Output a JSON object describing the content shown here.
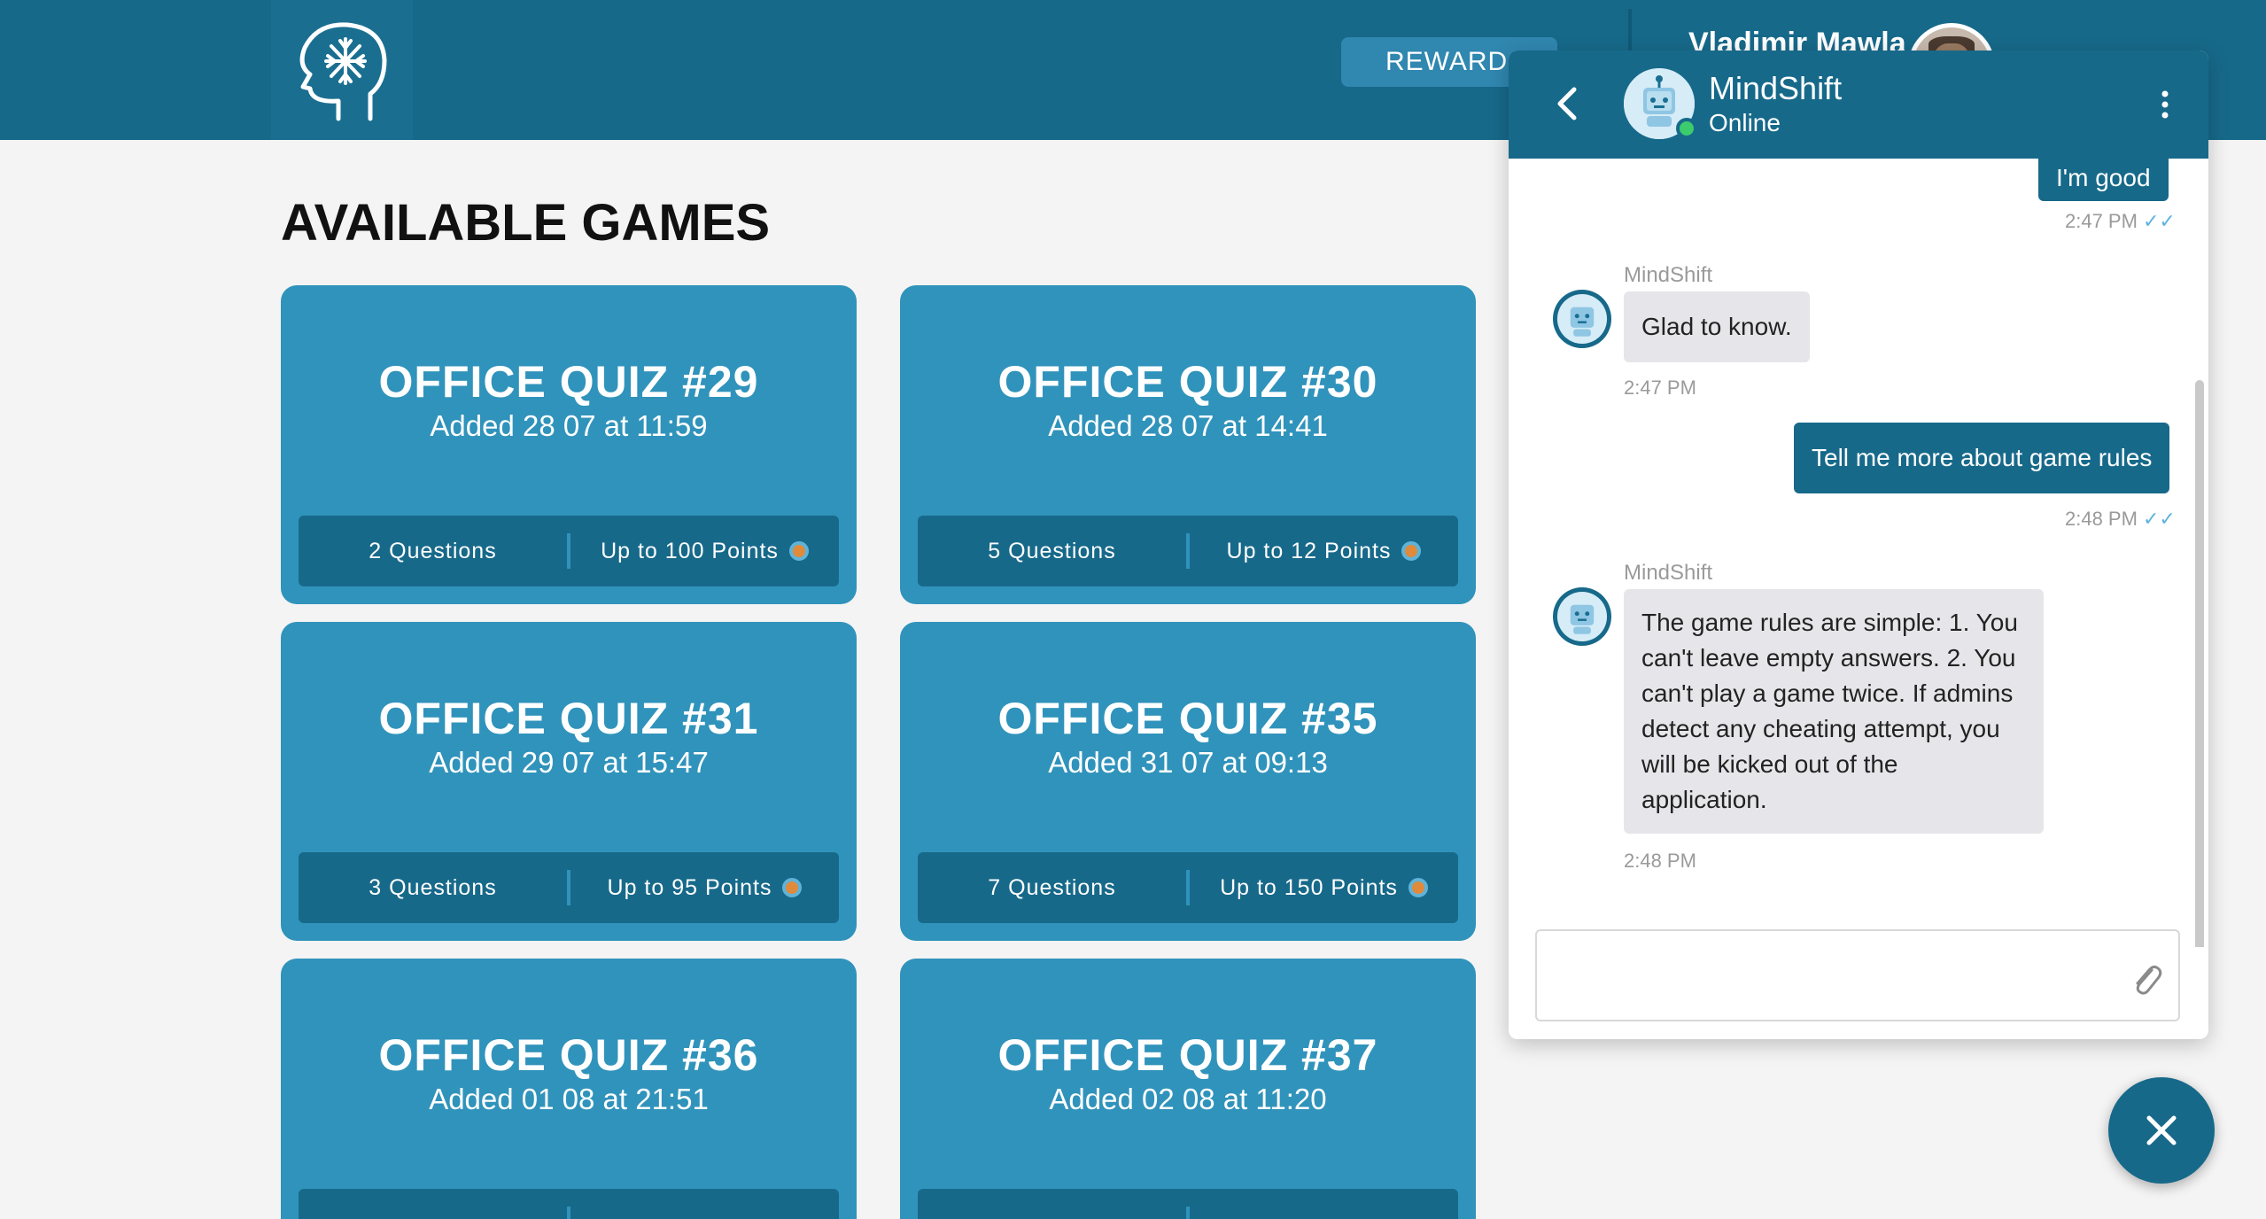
{
  "header": {
    "rewards_label": "REWARDS",
    "user_name": "Vladimir Mawla"
  },
  "main": {
    "title": "AVAILABLE GAMES",
    "games": [
      {
        "title": "OFFICE QUIZ #29",
        "added": "Added 28 07 at 11:59",
        "questions": "2 Questions",
        "points": "Up to 100 Points"
      },
      {
        "title": "OFFICE QUIZ #30",
        "added": "Added 28 07 at 14:41",
        "questions": "5 Questions",
        "points": "Up to 12 Points"
      },
      {
        "title": "OFFICE QUIZ #31",
        "added": "Added 29 07 at 15:47",
        "questions": "3 Questions",
        "points": "Up to 95 Points"
      },
      {
        "title": "OFFICE QUIZ #35",
        "added": "Added 31 07 at 09:13",
        "questions": "7 Questions",
        "points": "Up to 150 Points"
      },
      {
        "title": "OFFICE QUIZ #36",
        "added": "Added 01 08 at 21:51",
        "questions": "",
        "points": ""
      },
      {
        "title": "OFFICE QUIZ #37",
        "added": "Added 02 08 at 11:20",
        "questions": "",
        "points": ""
      }
    ]
  },
  "chat": {
    "title": "MindShift",
    "status": "Online",
    "messages": [
      {
        "from": "user",
        "text": "I'm good",
        "time": "2:47 PM"
      },
      {
        "from": "bot",
        "sender": "MindShift",
        "text": "Glad to know.",
        "time": "2:47 PM"
      },
      {
        "from": "user",
        "text": "Tell me more about game rules",
        "time": "2:48 PM"
      },
      {
        "from": "bot",
        "sender": "MindShift",
        "lines": [
          "The game rules are simple: 1. You",
          "can't leave empty answers. 2. You",
          "can't play a game twice. If admins",
          "detect any cheating attempt, you",
          "will be kicked out of the",
          "application."
        ],
        "time": "2:48 PM"
      }
    ],
    "input_value": ""
  },
  "icons": {
    "logo": "brain-head-icon",
    "back": "chevron-left-icon",
    "menu": "more-vertical-icon",
    "attach": "paperclip-icon",
    "close": "close-icon",
    "read": "double-check-icon"
  },
  "colors": {
    "header": "#17698a",
    "card": "#3093bb",
    "card_bar": "#17698a",
    "online": "#3ccc6e",
    "coin": "#e08a3c"
  }
}
